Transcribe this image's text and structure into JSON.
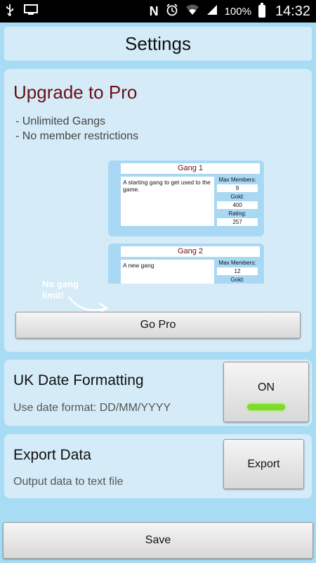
{
  "status_bar": {
    "battery": "100%",
    "time": "14:32",
    "icons": [
      "usb-icon",
      "screen-icon",
      "nfc-icon",
      "alarm-icon",
      "wifi-icon",
      "signal-icon",
      "battery-icon"
    ]
  },
  "header": {
    "title": "Settings"
  },
  "pro": {
    "title": "Upgrade to Pro",
    "features": [
      "- Unlimited Gangs",
      "- No member restrictions"
    ],
    "preview": {
      "callout": [
        "No gang",
        "limit!"
      ],
      "gangs": [
        {
          "name": "Gang 1",
          "description": "A starting gang to get used to the game.",
          "max_members_label": "Max Members:",
          "max_members": "9",
          "gold_label": "Gold:",
          "gold": "400",
          "rating_label": "Rating:",
          "rating": "257"
        },
        {
          "name": "Gang 2",
          "description": "A new gang",
          "max_members_label": "Max Members:",
          "max_members": "12",
          "gold_label": "Gold:"
        }
      ]
    },
    "button_label": "Go Pro"
  },
  "date_format": {
    "title": "UK Date Formatting",
    "subtitle": "Use date format: DD/MM/YYYY",
    "toggle_label": "ON",
    "toggle_on": true,
    "indicator_color": "#7ddc2a"
  },
  "export": {
    "title": "Export Data",
    "subtitle": "Output data to text file",
    "button_label": "Export"
  },
  "footer": {
    "save_label": "Save"
  },
  "colors": {
    "background": "#a8dcf5",
    "card": "#d5ecf8",
    "pro_title": "#6a0f16"
  }
}
